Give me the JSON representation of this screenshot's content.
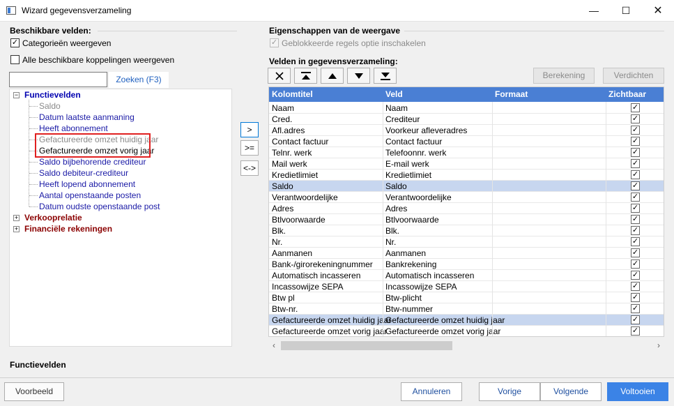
{
  "window": {
    "title": "Wizard gegevensverzameling",
    "minimize_glyph": "—",
    "maximize_glyph": "☐",
    "close_glyph": "✕"
  },
  "left": {
    "section_title": "Beschikbare velden:",
    "show_categories": {
      "label": "Categorieën weergeven",
      "checked": true
    },
    "show_links": {
      "label": "Alle beschikbare koppelingen weergeven",
      "checked": false
    },
    "search": {
      "value": "",
      "placeholder": "",
      "button_label": "Zoeken (F3)"
    },
    "tree": {
      "categories": [
        {
          "label": "Functievelden",
          "expanded": true,
          "expander": "−",
          "items": [
            "Saldo",
            "Datum laatste aanmaning",
            "Heeft abonnement",
            "Gefactureerde omzet huidig jaar",
            "Gefactureerde omzet vorig jaar",
            "Saldo bijbehorende crediteur",
            "Saldo debiteur-crediteur",
            "Heeft lopend abonnement",
            "Aantal openstaande posten",
            "Datum oudste openstaande post"
          ]
        },
        {
          "label": "Verkooprelatie",
          "expanded": false,
          "expander": "+"
        },
        {
          "label": "Financiële rekeningen",
          "expanded": false,
          "expander": "+"
        }
      ]
    }
  },
  "middle": {
    "add_label": ">",
    "add_all_label": ">=",
    "swap_label": "<->"
  },
  "right": {
    "props_title": "Eigenschappen van de weergave",
    "blocked_rows": {
      "label": "Geblokkeerde regels optie inschakelen",
      "checked": true,
      "disabled": true
    },
    "fields_title": "Velden in gegevensverzameling:",
    "move_buttons": [
      "remove-icon",
      "move-top-icon",
      "move-up-icon",
      "move-down-icon",
      "move-bottom-icon"
    ],
    "calc_label": "Berekening",
    "compress_label": "Verdichten",
    "grid": {
      "columns": [
        "Kolomtitel",
        "Veld",
        "Formaat",
        "Zichtbaar"
      ],
      "rows": [
        {
          "title": "Naam",
          "field": "Naam",
          "format": "",
          "visible": true
        },
        {
          "title": "Cred.",
          "field": "Crediteur",
          "format": "",
          "visible": true
        },
        {
          "title": "Afl.adres",
          "field": "Voorkeur afleveradres",
          "format": "",
          "visible": true
        },
        {
          "title": "Contact factuur",
          "field": "Contact factuur",
          "format": "",
          "visible": true
        },
        {
          "title": "Telnr. werk",
          "field": "Telefoonnr. werk",
          "format": "",
          "visible": true
        },
        {
          "title": "Mail werk",
          "field": "E-mail werk",
          "format": "",
          "visible": true
        },
        {
          "title": "Kredietlimiet",
          "field": "Kredietlimiet",
          "format": "",
          "visible": true
        },
        {
          "title": "Saldo",
          "field": "Saldo",
          "format": "",
          "visible": true,
          "selected": true
        },
        {
          "title": "Verantwoordelijke",
          "field": "Verantwoordelijke",
          "format": "",
          "visible": true
        },
        {
          "title": "Adres",
          "field": "Adres",
          "format": "",
          "visible": true
        },
        {
          "title": "Btlvoorwaarde",
          "field": "Btlvoorwaarde",
          "format": "",
          "visible": true
        },
        {
          "title": "Blk.",
          "field": "Blk.",
          "format": "",
          "visible": true
        },
        {
          "title": "Nr.",
          "field": "Nr.",
          "format": "",
          "visible": true
        },
        {
          "title": "Aanmanen",
          "field": "Aanmanen",
          "format": "",
          "visible": true
        },
        {
          "title": "Bank-/girorekeningnummer",
          "field": "Bankrekening",
          "format": "",
          "visible": true
        },
        {
          "title": "Automatisch incasseren",
          "field": "Automatisch incasseren",
          "format": "",
          "visible": true
        },
        {
          "title": "Incassowijze SEPA",
          "field": "Incassowijze SEPA",
          "format": "",
          "visible": true
        },
        {
          "title": "Btw pl",
          "field": "Btw-plicht",
          "format": "",
          "visible": true
        },
        {
          "title": "Btw-nr.",
          "field": "Btw-nummer",
          "format": "",
          "visible": true
        },
        {
          "title": "Gefactureerde omzet huidig jaar",
          "field": "Gefactureerde omzet huidig jaar",
          "format": "",
          "visible": true,
          "selected": true
        },
        {
          "title": "Gefactureerde omzet vorig jaar",
          "field": "Gefactureerde omzet vorig jaar",
          "format": "",
          "visible": true
        }
      ]
    },
    "scroll_left": "‹",
    "scroll_right": "›"
  },
  "status": {
    "text": "Functievelden"
  },
  "footer": {
    "preview_label": "Voorbeeld",
    "cancel_label": "Annuleren",
    "prev_label": "Vorige",
    "next_label": "Volgende",
    "finish_label": "Voltooien"
  },
  "colors": {
    "accent": "#4a7fd4",
    "selection": "#c7d6ef",
    "highlight_box": "#e02020",
    "category_blue": "#0000b0",
    "category_red": "#8b0000"
  }
}
